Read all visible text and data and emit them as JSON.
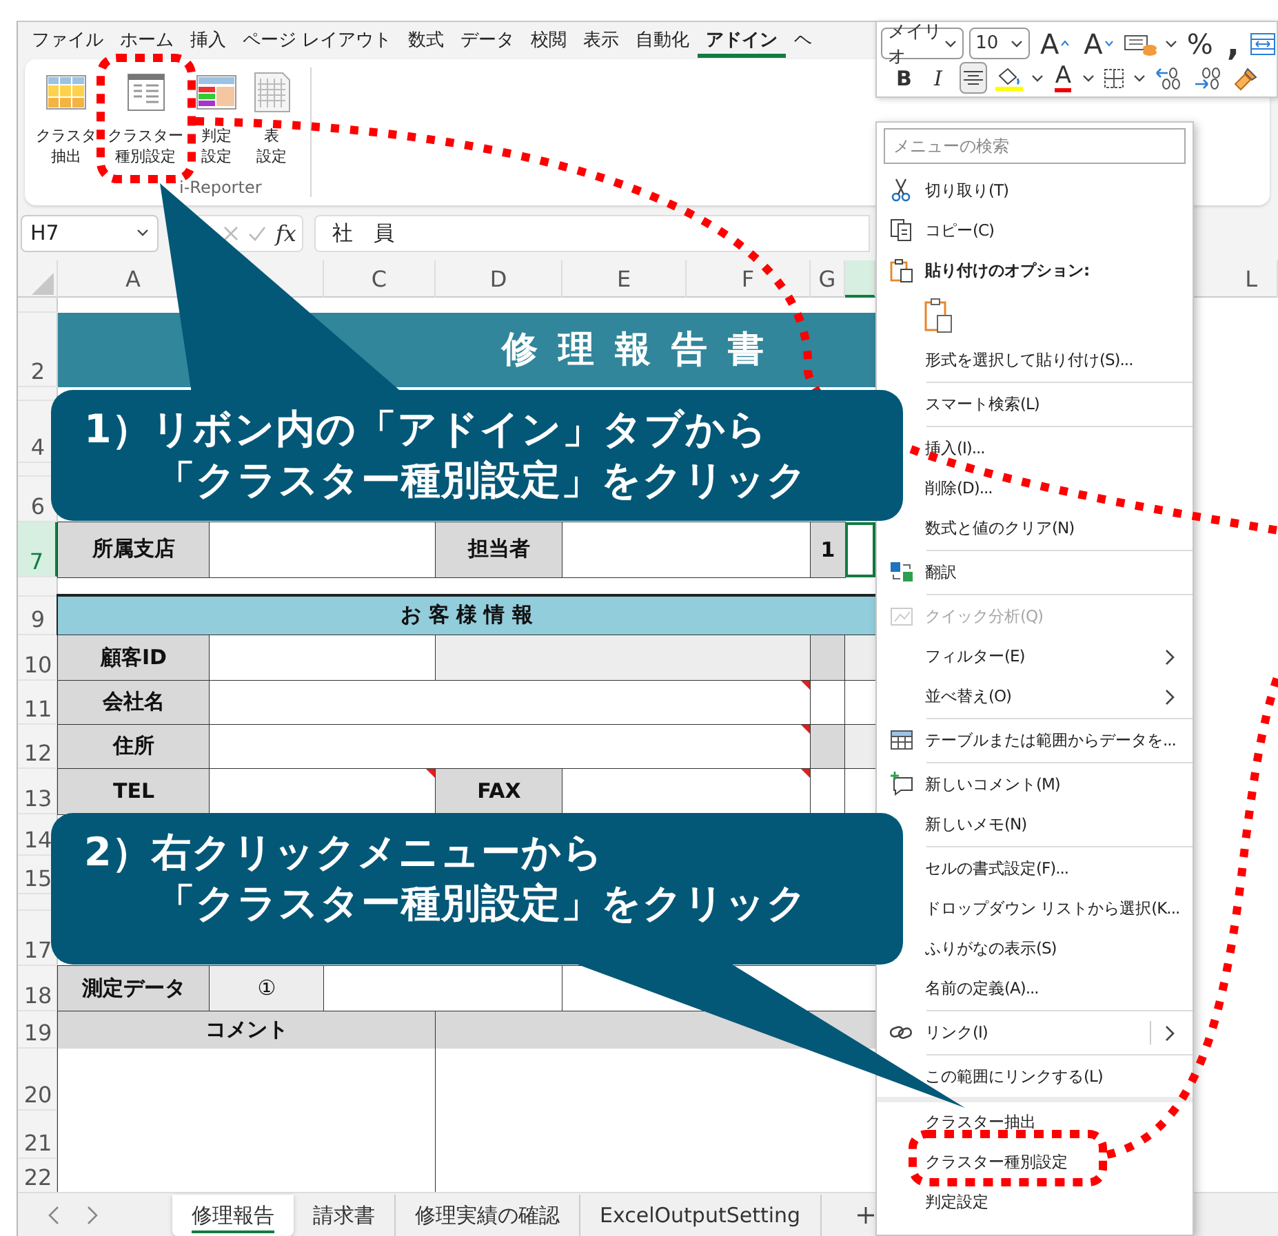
{
  "ribbon": {
    "tabs": [
      {
        "label": "ファイル",
        "selected": false
      },
      {
        "label": "ホーム",
        "selected": false
      },
      {
        "label": "挿入",
        "selected": false
      },
      {
        "label": "ページ レイアウト",
        "selected": false
      },
      {
        "label": "数式",
        "selected": false
      },
      {
        "label": "データ",
        "selected": false
      },
      {
        "label": "校閲",
        "selected": false
      },
      {
        "label": "表示",
        "selected": false
      },
      {
        "label": "自動化",
        "selected": false
      },
      {
        "label": "アドイン",
        "selected": true
      },
      {
        "label": "ヘ",
        "selected": false
      }
    ],
    "buttons": [
      {
        "lines": [
          "クラスタ",
          "抽出"
        ]
      },
      {
        "lines": [
          "クラスター",
          "種別設定"
        ]
      },
      {
        "lines": [
          "判定",
          "設定"
        ]
      },
      {
        "lines": [
          "表",
          "設定"
        ]
      }
    ],
    "group_label": "i-Reporter"
  },
  "mini_toolbar": {
    "font": "メイリオ",
    "size": "10",
    "row1": [
      {
        "kind": "grow",
        "label": "A"
      },
      {
        "kind": "shrink",
        "label": "A"
      },
      {
        "kind": "number-format"
      },
      {
        "kind": "percent",
        "label": "%"
      },
      {
        "kind": "comma",
        "label": ","
      },
      {
        "kind": "wrap"
      }
    ],
    "row2": [
      {
        "kind": "bold",
        "label": "B",
        "pressed": false
      },
      {
        "kind": "italic",
        "label": "I",
        "pressed": false
      },
      {
        "kind": "align",
        "pressed": true
      },
      {
        "kind": "fill",
        "pressed": false
      },
      {
        "kind": "font-color",
        "label": "A",
        "pressed": false
      },
      {
        "kind": "borders",
        "pressed": false
      },
      {
        "kind": "inc-decimal",
        "pressed": false
      },
      {
        "kind": "dec-decimal",
        "pressed": false
      },
      {
        "kind": "painter",
        "pressed": false
      }
    ]
  },
  "formula_bar": {
    "name_box": "H7",
    "function_symbol": "fx",
    "value": "社　員"
  },
  "sheet": {
    "columns": [
      {
        "label": "A",
        "selected": false
      },
      {},
      {
        "label": "C",
        "selected": false
      },
      {
        "label": "D",
        "selected": false
      },
      {
        "label": "E",
        "selected": false
      },
      {
        "label": "F",
        "selected": false
      },
      {
        "label": "G",
        "selected": false
      },
      {
        "selected": true
      },
      {
        "label": "L",
        "selected": false
      }
    ],
    "rows": [
      {},
      {
        "number": "2",
        "selected": false,
        "cells": [
          {
            "kind": "title",
            "text": "修 理 報 告 書"
          }
        ]
      },
      {},
      {
        "number": "4",
        "selected": false
      },
      {},
      {
        "number": "6",
        "selected": false
      },
      {
        "number": "7",
        "selected": true,
        "cells": [
          {
            "kind": "label",
            "text": "所属支店"
          },
          {
            "kind": "input"
          },
          {
            "kind": "label",
            "text": "担当者"
          },
          {
            "kind": "input"
          },
          {
            "kind": "label",
            "text": "1"
          },
          {
            "kind": "active"
          }
        ]
      },
      {},
      {
        "number": "9",
        "selected": false,
        "cells": [
          {
            "kind": "section",
            "text": "お 客 様 情 報"
          }
        ]
      },
      {
        "number": "10",
        "selected": false,
        "cells": [
          {
            "kind": "label",
            "text": "顧客ID"
          },
          {
            "kind": "input"
          },
          {
            "kind": "shade"
          },
          {
            "kind": "label"
          },
          {
            "kind": "shade"
          }
        ]
      },
      {
        "number": "11",
        "selected": false,
        "cells": [
          {
            "kind": "label",
            "text": "会社名"
          },
          {
            "kind": "input",
            "comment_mark": true
          },
          {
            "kind": "input"
          },
          {
            "kind": "input"
          }
        ]
      },
      {
        "number": "12",
        "selected": false,
        "cells": [
          {
            "kind": "label",
            "text": "住所"
          },
          {
            "kind": "input",
            "comment_mark": true
          },
          {
            "kind": "label"
          },
          {
            "kind": "shade"
          }
        ]
      },
      {
        "number": "13",
        "selected": false,
        "cells": [
          {
            "kind": "label",
            "text": "TEL"
          },
          {
            "kind": "input",
            "comment_mark": true
          },
          {
            "kind": "label",
            "text": "FAX"
          },
          {
            "kind": "input",
            "comment_mark": true
          },
          {
            "kind": "input"
          },
          {
            "kind": "input"
          }
        ]
      },
      {
        "number": "14",
        "selected": false
      },
      {
        "number": "15",
        "selected": false
      },
      {},
      {
        "number": "17",
        "selected": false
      },
      {
        "number": "18",
        "selected": false,
        "cells": [
          {
            "kind": "label",
            "text": "測定データ"
          },
          {
            "kind": "shade",
            "text": "①"
          },
          {
            "kind": "input"
          },
          {
            "kind": "input"
          }
        ]
      },
      {
        "number": "19",
        "selected": false,
        "cells": [
          {
            "kind": "label",
            "text": "コメント"
          },
          {
            "kind": "label"
          }
        ]
      },
      {
        "number": "20",
        "selected": false,
        "cells": [
          {
            "kind": "open"
          },
          {
            "kind": "open"
          }
        ]
      },
      {
        "number": "21",
        "selected": false,
        "cells": [
          {
            "kind": "open"
          },
          {
            "kind": "open"
          }
        ]
      },
      {
        "number": "22",
        "selected": false,
        "cells": [
          {
            "kind": "open"
          },
          {
            "kind": "open"
          }
        ]
      }
    ]
  },
  "sheet_tabs": [
    {
      "label": "修理報告",
      "selected": true
    },
    {
      "label": "請求書",
      "selected": false
    },
    {
      "label": "修理実績の確認",
      "selected": false
    },
    {
      "label": "ExcelOutputSetting",
      "selected": false
    }
  ],
  "context_menu": {
    "search_placeholder": "メニューの検索",
    "items": [
      {
        "kind": "item",
        "label": "切り取り(T)",
        "disabled": false,
        "submenu": false
      },
      {
        "kind": "item",
        "label": "コピー(C)",
        "disabled": false,
        "submenu": false
      },
      {
        "kind": "header",
        "label": "貼り付けのオプション:",
        "disabled": false,
        "submenu": false
      },
      {
        "kind": "paste-options"
      },
      {
        "kind": "item",
        "label": "形式を選択して貼り付け(S)...",
        "disabled": false,
        "submenu": false
      },
      {
        "kind": "separator"
      },
      {
        "kind": "item",
        "label": "スマート検索(L)",
        "disabled": false,
        "submenu": false
      },
      {
        "kind": "separator"
      },
      {
        "kind": "item",
        "label": "挿入(I)...",
        "disabled": false,
        "submenu": false
      },
      {
        "kind": "item",
        "label": "削除(D)...",
        "disabled": false,
        "submenu": false
      },
      {
        "kind": "item",
        "label": "数式と値のクリア(N)",
        "disabled": false,
        "submenu": false
      },
      {
        "kind": "separator"
      },
      {
        "kind": "item",
        "label": "翻訳",
        "disabled": false,
        "submenu": false
      },
      {
        "kind": "separator"
      },
      {
        "kind": "item",
        "label": "クイック分析(Q)",
        "disabled": true,
        "submenu": false
      },
      {
        "kind": "item",
        "label": "フィルター(E)",
        "disabled": false,
        "submenu": true
      },
      {
        "kind": "item",
        "label": "並べ替え(O)",
        "disabled": false,
        "submenu": true
      },
      {
        "kind": "separator"
      },
      {
        "kind": "item",
        "label": "テーブルまたは範囲からデータを...",
        "disabled": false,
        "submenu": false
      },
      {
        "kind": "separator"
      },
      {
        "kind": "item",
        "label": "新しいコメント(M)",
        "disabled": false,
        "submenu": false
      },
      {
        "kind": "item",
        "label": "新しいメモ(N)",
        "disabled": false,
        "submenu": false
      },
      {
        "kind": "separator"
      },
      {
        "kind": "item",
        "label": "セルの書式設定(F)...",
        "disabled": false,
        "submenu": false
      },
      {
        "kind": "item",
        "label": "ドロップダウン リストから選択(K...",
        "disabled": false,
        "submenu": false
      },
      {
        "kind": "item",
        "label": "ふりがなの表示(S)",
        "disabled": false,
        "submenu": false
      },
      {
        "kind": "item",
        "label": "名前の定義(A)...",
        "disabled": false,
        "submenu": false
      },
      {
        "kind": "separator"
      },
      {
        "kind": "item",
        "label": "リンク(I)",
        "disabled": false,
        "submenu": true
      },
      {
        "kind": "separator"
      },
      {
        "kind": "item",
        "label": "この範囲にリンクする(L)",
        "disabled": false,
        "submenu": false
      },
      {
        "kind": "band"
      },
      {
        "kind": "item",
        "label": "クラスター抽出",
        "disabled": false,
        "submenu": false
      },
      {
        "kind": "item",
        "label": "クラスター種別設定",
        "disabled": false,
        "submenu": false
      },
      {
        "kind": "item",
        "label": "判定設定",
        "disabled": false,
        "submenu": false
      }
    ]
  },
  "callouts": [
    {
      "lines": [
        "1）リボン内の「アドイン」タブから",
        "「クラスター種別設定」をクリック"
      ]
    },
    {
      "lines": [
        "2）右クリックメニューから",
        "「クラスター種別設定」をクリック"
      ]
    }
  ]
}
